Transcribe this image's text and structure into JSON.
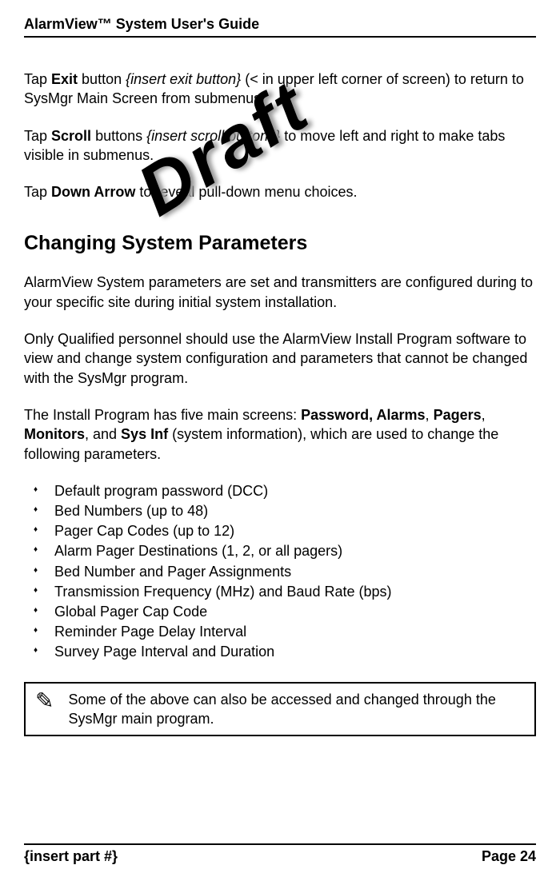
{
  "header": {
    "title": "AlarmView™ System User's Guide"
  },
  "watermark": "Draft",
  "body": {
    "para1": {
      "pre": "Tap ",
      "btn": "Exit",
      "mid": " button ",
      "placeholder": "{insert exit button}",
      "post": " (< in upper left corner of screen) to return to SysMgr Main Screen from submenus."
    },
    "para2": {
      "pre": "Tap ",
      "btn": "Scroll",
      "mid": " buttons ",
      "placeholder": "{insert scroll buttons}",
      "post": " to move left and right to make tabs visible in submenus."
    },
    "para3": {
      "pre": "Tap ",
      "btn": "Down Arrow",
      "post": " to reveal pull-down menu choices."
    },
    "section_heading": "Changing System Parameters",
    "para4": "AlarmView System parameters are set and transmitters are configured during to your specific site during initial system installation.",
    "para5": "Only Qualified personnel should use the AlarmView Install Program software to view and change system configuration and parameters that cannot be changed with the SysMgr program.",
    "para6": {
      "pre": "The Install Program has five main screens: ",
      "b1": "Password, Alarms",
      "sep1": ", ",
      "b2": "Pagers",
      "sep2": ", ",
      "b3": "Monitors",
      "sep3": ", and ",
      "b4": "Sys Inf",
      "post": " (system information), which are used to change the following parameters."
    },
    "bullets": [
      "Default program password (DCC)",
      "Bed Numbers (up to 48)",
      "Pager Cap Codes (up to 12)",
      "Alarm Pager Destinations (1, 2, or all pagers)",
      "Bed Number and Pager Assignments",
      "Transmission Frequency (MHz) and Baud Rate (bps)",
      "Global Pager Cap Code",
      "Reminder Page Delay Interval",
      "Survey Page Interval and Duration"
    ],
    "note": "Some of the above can also be accessed and changed through the SysMgr main program."
  },
  "footer": {
    "left": "{insert part #}",
    "right": "Page 24"
  }
}
